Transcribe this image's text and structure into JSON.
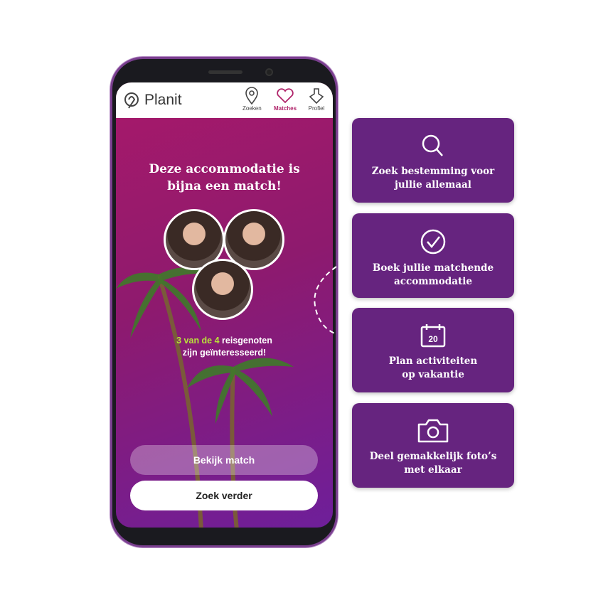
{
  "app": {
    "name": "Planit",
    "nav": [
      {
        "label": "Zoeken",
        "icon": "map-pin-icon"
      },
      {
        "label": "Matches",
        "icon": "heart-icon",
        "active": true
      },
      {
        "label": "Profiel",
        "icon": "profile-icon"
      }
    ]
  },
  "main": {
    "title_line1": "Deze accommodatie is",
    "title_line2": "bijna een match!",
    "count_highlight": "3 van de 4",
    "count_rest": " reisgenoten",
    "count_line2": "zijn geïnteresseerd!",
    "view_button": "Bekijk match",
    "search_button": "Zoek verder"
  },
  "features": [
    {
      "icon": "search-icon",
      "line1": "Zoek bestemming voor",
      "line2": "jullie allemaal"
    },
    {
      "icon": "check-circle-icon",
      "line1": "Boek jullie matchende",
      "line2": "accommodatie"
    },
    {
      "icon": "calendar-icon",
      "icon_text": "20",
      "line1": "Plan activiteiten",
      "line2": "op vakantie"
    },
    {
      "icon": "camera-icon",
      "line1": "Deel gemakkelijk foto’s",
      "line2": "met elkaar"
    }
  ],
  "colors": {
    "card": "#66247f",
    "accent": "#b0246a",
    "highlight": "#b9e23a"
  }
}
